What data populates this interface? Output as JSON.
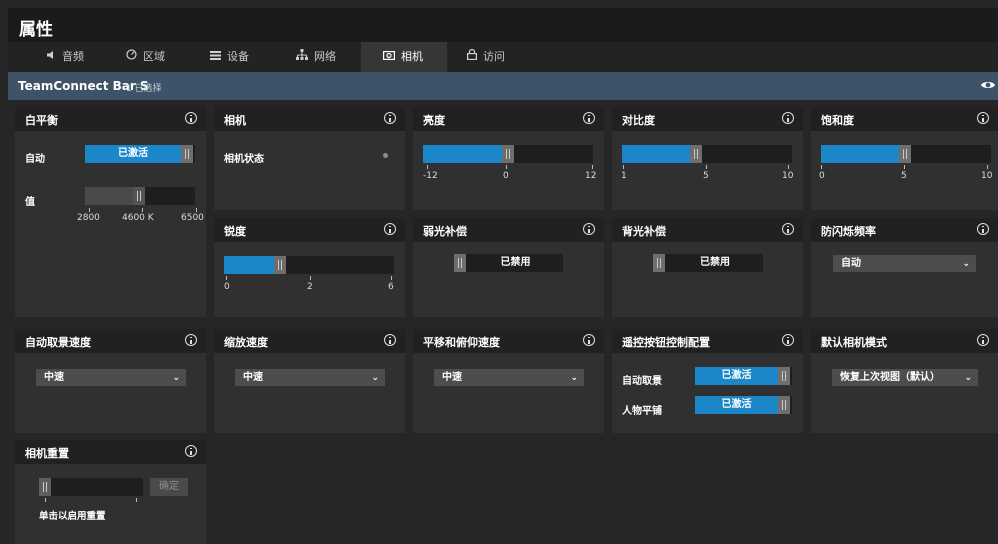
{
  "window": {
    "title": "属性"
  },
  "tabs": [
    {
      "label": "音频",
      "icon": "speaker-icon"
    },
    {
      "label": "区域",
      "icon": "zone-icon"
    },
    {
      "label": "设备",
      "icon": "device-icon"
    },
    {
      "label": "网络",
      "icon": "network-icon"
    },
    {
      "label": "相机",
      "icon": "camera-icon",
      "active": true
    },
    {
      "label": "访问",
      "icon": "lock-icon"
    }
  ],
  "device": {
    "name": "TeamConnect Bar S",
    "selected": "1 已选择"
  },
  "colors": {
    "accent": "#1b87c9",
    "device_bar": "#3e5368",
    "panel": "#303030",
    "header": "#212121"
  },
  "panels": {
    "white_balance": {
      "title": "白平衡",
      "auto_label": "自动",
      "auto_state": "已激活",
      "value_label": "值",
      "scale": [
        "2800",
        "4600 K",
        "6500"
      ],
      "value_fraction": 0.5
    },
    "camera": {
      "title": "相机",
      "status_label": "相机状态"
    },
    "brightness": {
      "title": "亮度",
      "scale": [
        "-12",
        "0",
        "12"
      ],
      "value": 0
    },
    "contrast": {
      "title": "对比度",
      "scale": [
        "1",
        "5",
        "10"
      ],
      "value": 5
    },
    "saturation": {
      "title": "饱和度",
      "scale": [
        "0",
        "5",
        "10"
      ],
      "value": 5
    },
    "sharpness": {
      "title": "锐度",
      "scale": [
        "0",
        "2",
        "6"
      ],
      "value": 2
    },
    "low_light": {
      "title": "弱光补偿",
      "state": "已禁用"
    },
    "backlight": {
      "title": "背光补偿",
      "state": "已禁用"
    },
    "anti_flicker": {
      "title": "防闪烁频率",
      "value": "自动"
    },
    "auto_framing_speed": {
      "title": "自动取景速度",
      "value": "中速"
    },
    "zoom_speed": {
      "title": "缩放速度",
      "value": "中速"
    },
    "pan_tilt_speed": {
      "title": "平移和俯仰速度",
      "value": "中速"
    },
    "remote_config": {
      "title": "遥控按钮控制配置",
      "rows": [
        {
          "label": "自动取景",
          "state": "已激活"
        },
        {
          "label": "人物平铺",
          "state": "已激活"
        }
      ]
    },
    "default_mode": {
      "title": "默认相机模式",
      "value": "恢复上次视图（默认）"
    },
    "camera_reset": {
      "title": "相机重置",
      "confirm": "确定",
      "hint": "单击以启用重置"
    }
  }
}
